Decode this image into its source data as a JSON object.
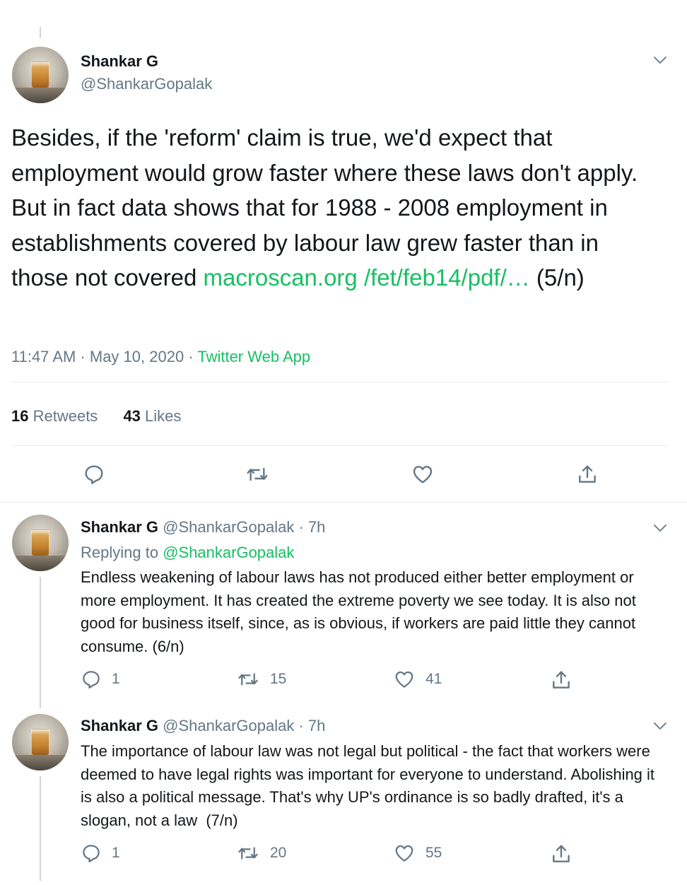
{
  "main_tweet": {
    "author_name": "Shankar G",
    "author_handle": "@ShankarGopalak",
    "text": "Besides, if the 'reform' claim is true, we'd expect that employment would grow faster where these laws don't apply. But in fact data shows that for 1988 - 2008 employment in establishments covered by labour law grew faster than in those not covered ",
    "link_text": "macroscan.org /fet/feb14/pdf/…",
    "text_suffix": " (5/n)",
    "timestamp": "11:47 AM · May 10, 2020 · ",
    "source": "Twitter Web App",
    "retweets_count": "16",
    "retweets_label": " Retweets",
    "likes_count": "43",
    "likes_label": " Likes"
  },
  "replies": [
    {
      "author_name": "Shankar G",
      "author_meta": " @ShankarGopalak · 7h",
      "replying_prefix": "Replying to ",
      "replying_handle": "@ShankarGopalak",
      "text": "Endless weakening of labour laws has not produced either better employment or more employment. It has created the extreme poverty we see today. It is also not good for business itself, since, as is obvious, if workers are paid little they cannot consume. (6/n)",
      "reply_count": "1",
      "retweet_count": "15",
      "like_count": "41"
    },
    {
      "author_name": "Shankar G",
      "author_meta": " @ShankarGopalak · 7h",
      "text": "The importance of labour law was not legal but political - the fact that workers were deemed to have legal rights was important for everyone to understand. Abolishing it is also a political message. That's why UP's ordinance is so badly drafted, it's a slogan, not a law  (7/n)",
      "reply_count": "1",
      "retweet_count": "20",
      "like_count": "55"
    }
  ],
  "icons": {
    "reply": "reply-icon",
    "retweet": "retweet-icon",
    "like": "heart-icon",
    "share": "share-icon",
    "menu": "chevron-down-icon"
  },
  "colors": {
    "accent": "#17bf63",
    "muted": "#657786",
    "text": "#14171a",
    "divider": "#e6ecf0"
  }
}
